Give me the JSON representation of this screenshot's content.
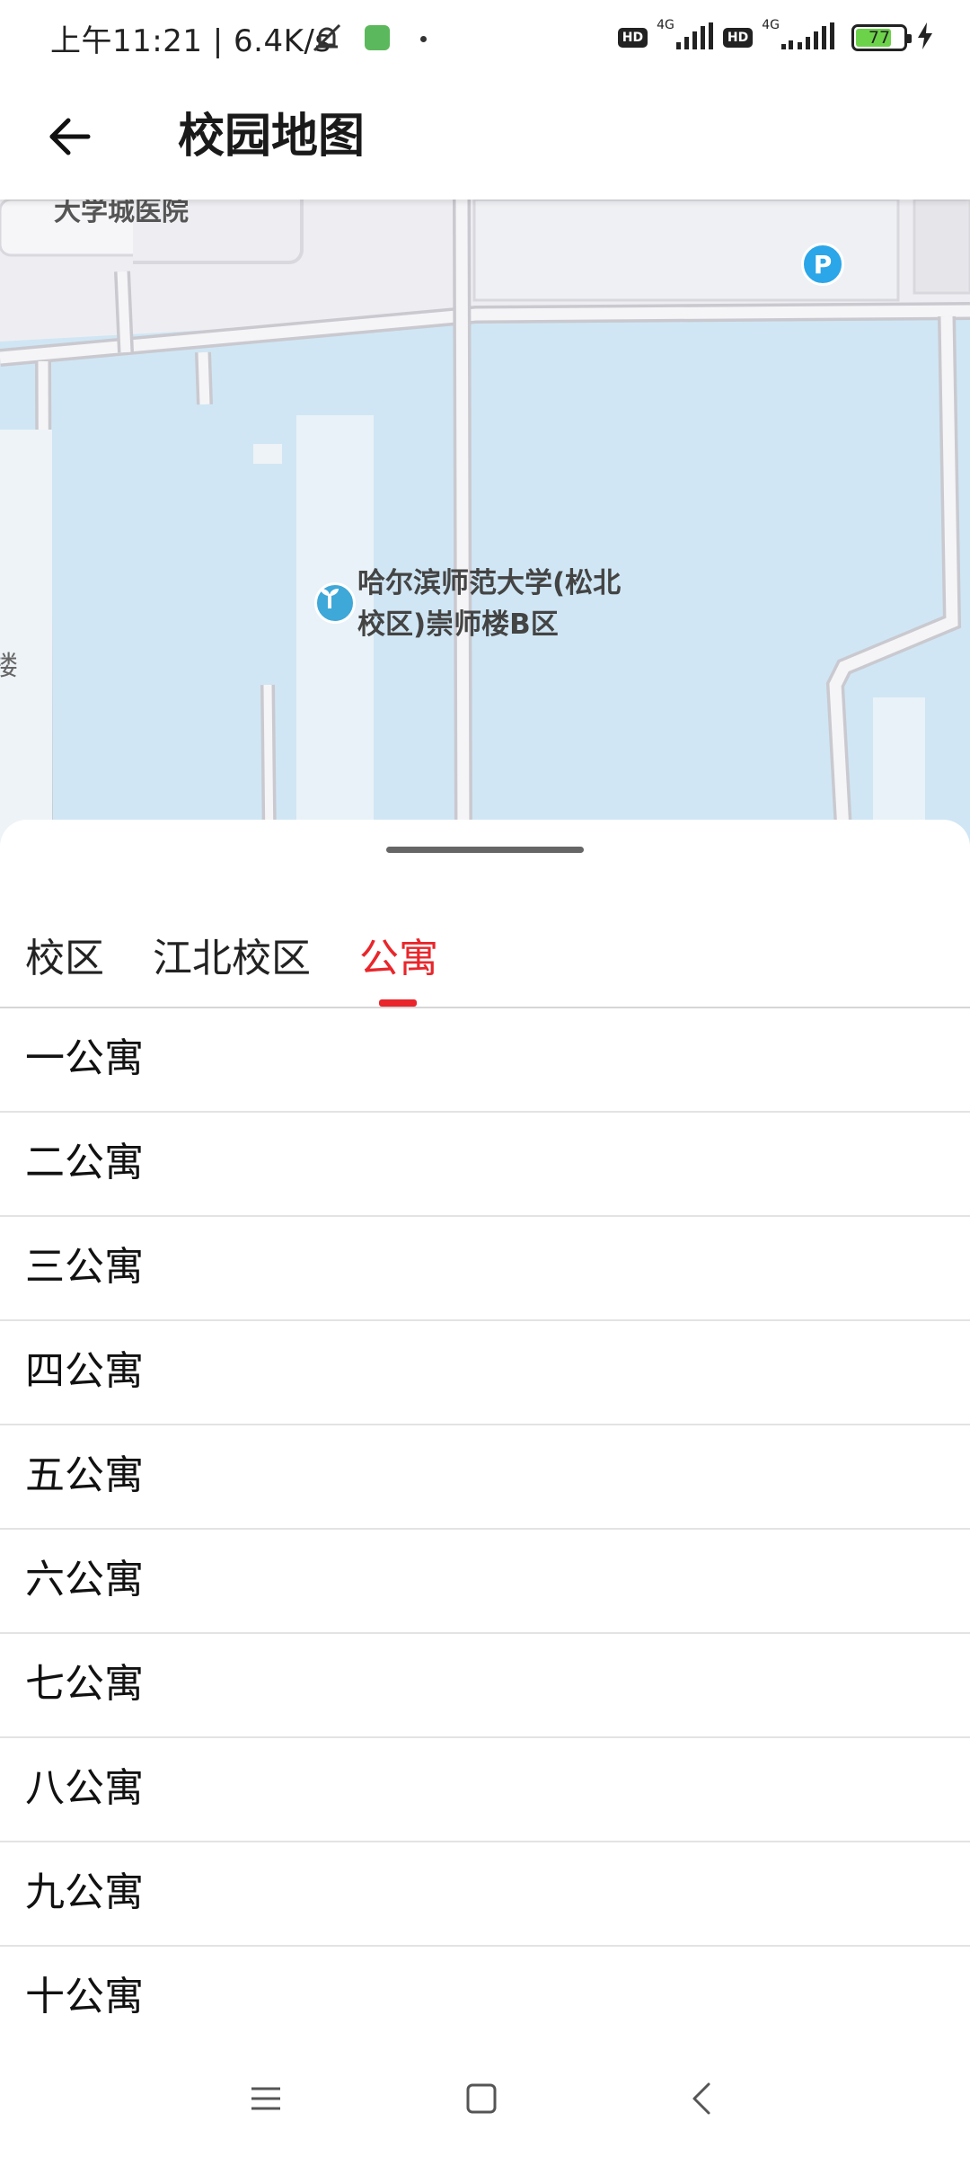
{
  "status_bar": {
    "time": "上午11:21 | 6.4K/s",
    "network_1": "4G",
    "network_2": "4G",
    "hd_1": "HD",
    "hd_2": "HD",
    "battery_percent": "77",
    "battery_level": 0.77
  },
  "header": {
    "title": "校园地图"
  },
  "map": {
    "poi_label": "哈尔滨师范大学(松北校区)崇师楼B区",
    "top_label": "大学城医院",
    "parking_label": "P",
    "edge_label": "楼"
  },
  "tabs": [
    {
      "label": "校区",
      "active": false
    },
    {
      "label": "江北校区",
      "active": false
    },
    {
      "label": "公寓",
      "active": true
    }
  ],
  "list": [
    {
      "label": "一公寓"
    },
    {
      "label": "二公寓"
    },
    {
      "label": "三公寓"
    },
    {
      "label": "四公寓"
    },
    {
      "label": "五公寓"
    },
    {
      "label": "六公寓"
    },
    {
      "label": "七公寓"
    },
    {
      "label": "八公寓"
    },
    {
      "label": "九公寓"
    },
    {
      "label": "十公寓"
    }
  ],
  "colors": {
    "accent": "#e8262b",
    "map_water": "#d0e6f4",
    "map_road": "#f4f4f6"
  }
}
